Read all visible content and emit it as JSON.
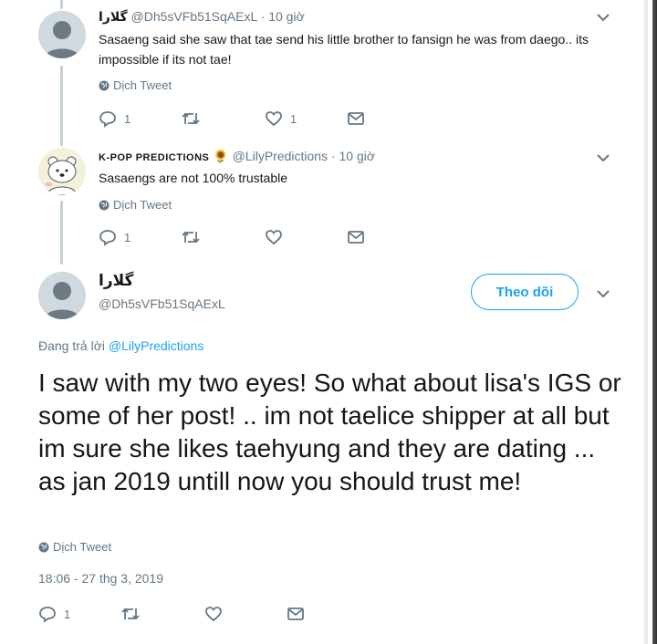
{
  "tweets": [
    {
      "name": "گلارا",
      "handle": "@Dh5sVFb51SqAExL",
      "time": "· 10 giờ",
      "text": "Sasaeng said she saw that tae send his little brother to fansign he was from daego.. its impossible if its not tae!",
      "translate_label": "Dịch Tweet",
      "reply_count": "1",
      "retweet_count": "",
      "like_count": "1",
      "avatar_icon": "default-person-avatar"
    },
    {
      "name": "K-POP PREDICTIONS",
      "emoji": "🌻",
      "handle": "@LilyPredictions",
      "time": "· 10 giờ",
      "text": "Sasaengs are not 100% trustable",
      "translate_label": "Dịch Tweet",
      "reply_count": "1",
      "retweet_count": "",
      "like_count": "",
      "avatar_icon": "polar-bear-avatar"
    }
  ],
  "main_tweet": {
    "name": "گلارا",
    "handle": "@Dh5sVFb51SqAExL",
    "follow_label": "Theo dõi",
    "replying_prefix": "Đang trả lời",
    "replying_to": "@LilyPredictions",
    "text": "I saw with my two eyes! So what about lisa's IGS or some of her post!  .. im not taelice shipper at all but im sure she likes taehyung and they are dating ... as jan 2019 untill now you should trust me!",
    "translate_label": "Dịch Tweet",
    "timestamp": "18:06 - 27 thg 3, 2019",
    "reply_count": "1",
    "retweet_count": "",
    "like_count": ""
  },
  "colors": {
    "accent": "#1da1f2",
    "secondary_text": "#657786",
    "thread_line": "#c4cfd6"
  }
}
